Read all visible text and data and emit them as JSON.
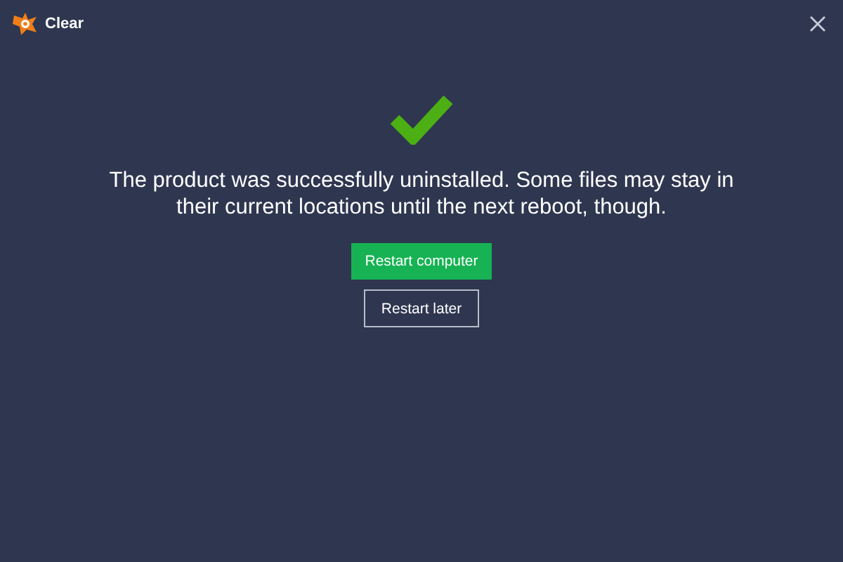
{
  "window": {
    "title": "Clear"
  },
  "message": "The product was successfully uninstalled. Some files may stay in their current locations until the next reboot, though.",
  "buttons": [
    {
      "label": "Restart computer",
      "kind": "primary"
    },
    {
      "label": "Restart later",
      "kind": "secondary"
    }
  ]
}
